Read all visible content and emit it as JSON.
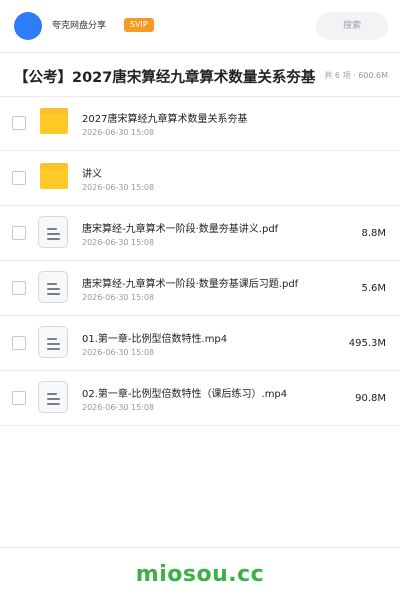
{
  "header": {
    "brand": "夸克网盘分享",
    "badge": "SVIP",
    "search_placeholder": "搜索",
    "avatar_color": "#2f7df6",
    "badge_color": "#f59a23"
  },
  "share": {
    "title": "【公考】2027唐宋算经九章算术数量关系夯基",
    "meta": "共 6 项 · 600.6M"
  },
  "files": [
    {
      "type": "folder",
      "icon": "folder-icon",
      "name": "2027唐宋算经九章算术数量关系夯基",
      "date": "2026-06-30 15:08",
      "size": ""
    },
    {
      "type": "folder",
      "icon": "folder-icon",
      "name": "讲义",
      "date": "2026-06-30 15:08",
      "size": ""
    },
    {
      "type": "file",
      "icon": "document-icon",
      "name": "唐宋算经-九章算术一阶段·数量夯基讲义.pdf",
      "date": "2026-06-30 15:08",
      "size": "8.8M"
    },
    {
      "type": "file",
      "icon": "document-icon",
      "name": "唐宋算经-九章算术一阶段·数量夯基课后习题.pdf",
      "date": "2026-06-30 15:08",
      "size": "5.6M"
    },
    {
      "type": "file",
      "icon": "document-icon",
      "name": "01.第一章-比例型倍数特性.mp4",
      "date": "2026-06-30 15:08",
      "size": "495.3M"
    },
    {
      "type": "file",
      "icon": "document-icon",
      "name": "02.第一章-比例型倍数特性（课后练习）.mp4",
      "date": "2026-06-30 15:08",
      "size": "90.8M"
    }
  ],
  "footer": {
    "watermark": "miosou.cc",
    "watermark_color": "#3cb043"
  }
}
